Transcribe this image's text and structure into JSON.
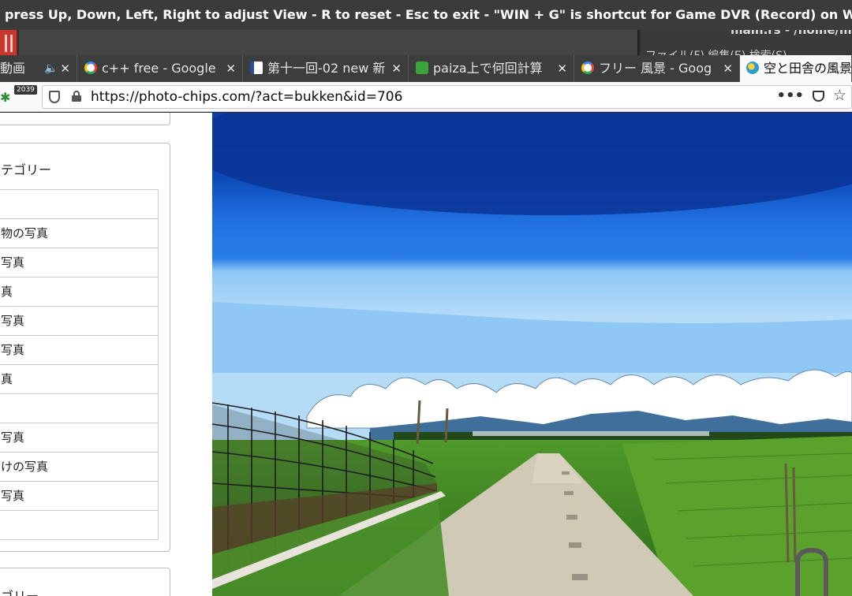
{
  "overlay": {
    "text": "press Up, Down, Left, Right to adjust View - R to reset - Esc to exit - \"WIN + G\" is shortcut for Game DVR (Record) on Wind..."
  },
  "background_window": {
    "path": "main.rs - /home/m",
    "menu": "ファイル(F)  編集(E)  検索(S)"
  },
  "tabs": [
    {
      "title": "動画",
      "icon": "speaker-icon",
      "audio": true
    },
    {
      "title": "c++ free - Google",
      "icon": "google-icon"
    },
    {
      "title": "第十一回-02 new 新",
      "icon": "doc-icon"
    },
    {
      "title": "paiza上で何回計算",
      "icon": "paiza-icon"
    },
    {
      "title": "フリー 風景 - Goog",
      "icon": "google-icon"
    },
    {
      "title": "空と田舎の風景",
      "icon": "photo-chips-icon",
      "active": true
    }
  ],
  "navbar": {
    "extension_badge": "2039",
    "url": "https://photo-chips.com/?act=bukken&id=706",
    "more_label": "•••"
  },
  "sidebar": {
    "heading": "テゴリー",
    "items": [
      "",
      "物の写真",
      "写真",
      "真",
      "写真",
      "写真",
      "真",
      "",
      "写真",
      "けの写真",
      "写真",
      ""
    ],
    "next_heading": "ゴリー"
  },
  "photo": {
    "subject": "countryside path, farm field, greenhouse, clouds, blue sky",
    "colors": {
      "sky_top": "#0a3ea8",
      "sky_mid": "#1f6fe0",
      "sky_low": "#8fc8f5",
      "cloud": "#ffffff",
      "mountain": "#3f6f9a",
      "field": "#4f9a2a",
      "field_dark": "#2f6a1a",
      "path": "#cfc9b6"
    }
  }
}
